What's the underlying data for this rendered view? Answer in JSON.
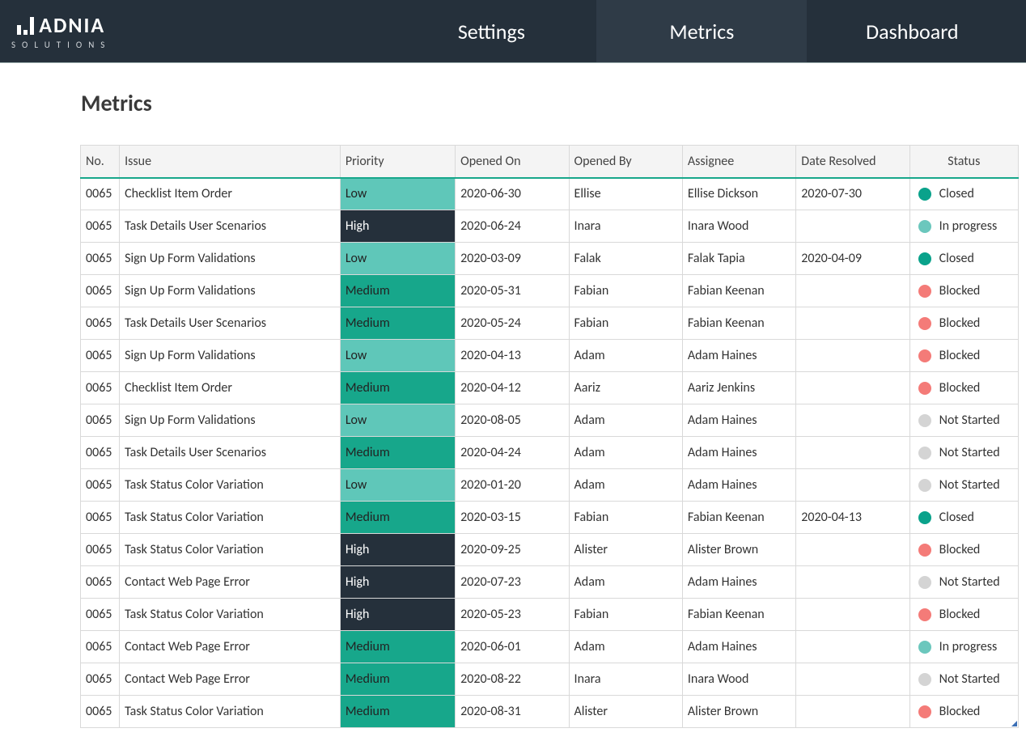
{
  "brand": {
    "name": "ADNIA",
    "sub": "SOLUTIONS"
  },
  "nav": [
    {
      "label": "Settings",
      "active": false
    },
    {
      "label": "Metrics",
      "active": true
    },
    {
      "label": "Dashboard",
      "active": false
    }
  ],
  "page_title": "Metrics",
  "columns": [
    "No.",
    "Issue",
    "Priority",
    "Opened On",
    "Opened By",
    "Assignee",
    "Date Resolved",
    "Status"
  ],
  "priority_colors": {
    "Low": "#5fc7b9",
    "Medium": "#17a78b",
    "High": "#25303b"
  },
  "status_colors": {
    "Closed": "#0aa28b",
    "In progress": "#6bc7bd",
    "Blocked": "#f47b78",
    "Not Started": "#d4d4d4"
  },
  "rows": [
    {
      "no": "0065",
      "issue": "Checklist Item Order",
      "priority": "Low",
      "opened_on": "2020-06-30",
      "opened_by": "Ellise",
      "assignee": "Ellise Dickson",
      "date_resolved": "2020-07-30",
      "status": "Closed"
    },
    {
      "no": "0065",
      "issue": "Task Details User Scenarios",
      "priority": "High",
      "opened_on": "2020-06-24",
      "opened_by": "Inara",
      "assignee": "Inara Wood",
      "date_resolved": "",
      "status": "In progress"
    },
    {
      "no": "0065",
      "issue": "Sign Up Form Validations",
      "priority": "Low",
      "opened_on": "2020-03-09",
      "opened_by": "Falak",
      "assignee": "Falak Tapia",
      "date_resolved": "2020-04-09",
      "status": "Closed"
    },
    {
      "no": "0065",
      "issue": "Sign Up Form Validations",
      "priority": "Medium",
      "opened_on": "2020-05-31",
      "opened_by": "Fabian",
      "assignee": "Fabian Keenan",
      "date_resolved": "",
      "status": "Blocked"
    },
    {
      "no": "0065",
      "issue": "Task Details User Scenarios",
      "priority": "Medium",
      "opened_on": "2020-05-24",
      "opened_by": "Fabian",
      "assignee": "Fabian Keenan",
      "date_resolved": "",
      "status": "Blocked"
    },
    {
      "no": "0065",
      "issue": "Sign Up Form Validations",
      "priority": "Low",
      "opened_on": "2020-04-13",
      "opened_by": "Adam",
      "assignee": "Adam Haines",
      "date_resolved": "",
      "status": "Blocked"
    },
    {
      "no": "0065",
      "issue": "Checklist Item Order",
      "priority": "Medium",
      "opened_on": "2020-04-12",
      "opened_by": "Aariz",
      "assignee": "Aariz Jenkins",
      "date_resolved": "",
      "status": "Blocked"
    },
    {
      "no": "0065",
      "issue": "Sign Up Form Validations",
      "priority": "Low",
      "opened_on": "2020-08-05",
      "opened_by": "Adam",
      "assignee": "Adam Haines",
      "date_resolved": "",
      "status": "Not Started"
    },
    {
      "no": "0065",
      "issue": "Task Details User Scenarios",
      "priority": "Medium",
      "opened_on": "2020-04-24",
      "opened_by": "Adam",
      "assignee": "Adam Haines",
      "date_resolved": "",
      "status": "Not Started"
    },
    {
      "no": "0065",
      "issue": "Task Status Color Variation",
      "priority": "Low",
      "opened_on": "2020-01-20",
      "opened_by": "Adam",
      "assignee": "Adam Haines",
      "date_resolved": "",
      "status": "Not Started"
    },
    {
      "no": "0065",
      "issue": "Task Status Color Variation",
      "priority": "Medium",
      "opened_on": "2020-03-15",
      "opened_by": "Fabian",
      "assignee": "Fabian Keenan",
      "date_resolved": "2020-04-13",
      "status": "Closed"
    },
    {
      "no": "0065",
      "issue": "Task Status Color Variation",
      "priority": "High",
      "opened_on": "2020-09-25",
      "opened_by": "Alister",
      "assignee": "Alister Brown",
      "date_resolved": "",
      "status": "Blocked"
    },
    {
      "no": "0065",
      "issue": "Contact Web Page Error",
      "priority": "High",
      "opened_on": "2020-07-23",
      "opened_by": "Adam",
      "assignee": "Adam Haines",
      "date_resolved": "",
      "status": "Not Started"
    },
    {
      "no": "0065",
      "issue": "Task Status Color Variation",
      "priority": "High",
      "opened_on": "2020-05-23",
      "opened_by": "Fabian",
      "assignee": "Fabian Keenan",
      "date_resolved": "",
      "status": "Blocked"
    },
    {
      "no": "0065",
      "issue": "Contact Web Page Error",
      "priority": "Medium",
      "opened_on": "2020-06-01",
      "opened_by": "Adam",
      "assignee": "Adam Haines",
      "date_resolved": "",
      "status": "In progress"
    },
    {
      "no": "0065",
      "issue": "Contact Web Page Error",
      "priority": "Medium",
      "opened_on": "2020-08-22",
      "opened_by": "Inara",
      "assignee": "Inara Wood",
      "date_resolved": "",
      "status": "Not Started"
    },
    {
      "no": "0065",
      "issue": "Task Status Color Variation",
      "priority": "Medium",
      "opened_on": "2020-08-31",
      "opened_by": "Alister",
      "assignee": "Alister Brown",
      "date_resolved": "",
      "status": "Blocked"
    }
  ]
}
